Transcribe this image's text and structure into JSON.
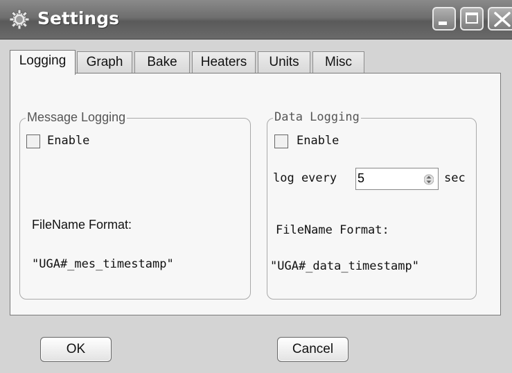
{
  "window": {
    "title": "Settings",
    "icon": "gear-icon",
    "controls": [
      "minimize-icon",
      "maximize-icon",
      "close-icon"
    ]
  },
  "tabs": [
    {
      "label": "Logging",
      "active": true
    },
    {
      "label": "Graph",
      "active": false
    },
    {
      "label": "Bake",
      "active": false
    },
    {
      "label": "Heaters",
      "active": false
    },
    {
      "label": "Units",
      "active": false
    },
    {
      "label": "Misc",
      "active": false
    }
  ],
  "message_logging": {
    "legend": "Message Logging",
    "enable_label": "Enable",
    "enable_checked": false,
    "filename_label": "FileName Format:",
    "filename_value": "\"UGA#_mes_timestamp\""
  },
  "data_logging": {
    "legend": "Data Logging",
    "enable_label": "Enable",
    "enable_checked": false,
    "log_every_label": "log every",
    "log_every_value": "5",
    "log_every_unit": "sec",
    "filename_label": "FileName Format:",
    "filename_value": "\"UGA#_data_timestamp\""
  },
  "buttons": {
    "ok": "OK",
    "cancel": "Cancel"
  }
}
